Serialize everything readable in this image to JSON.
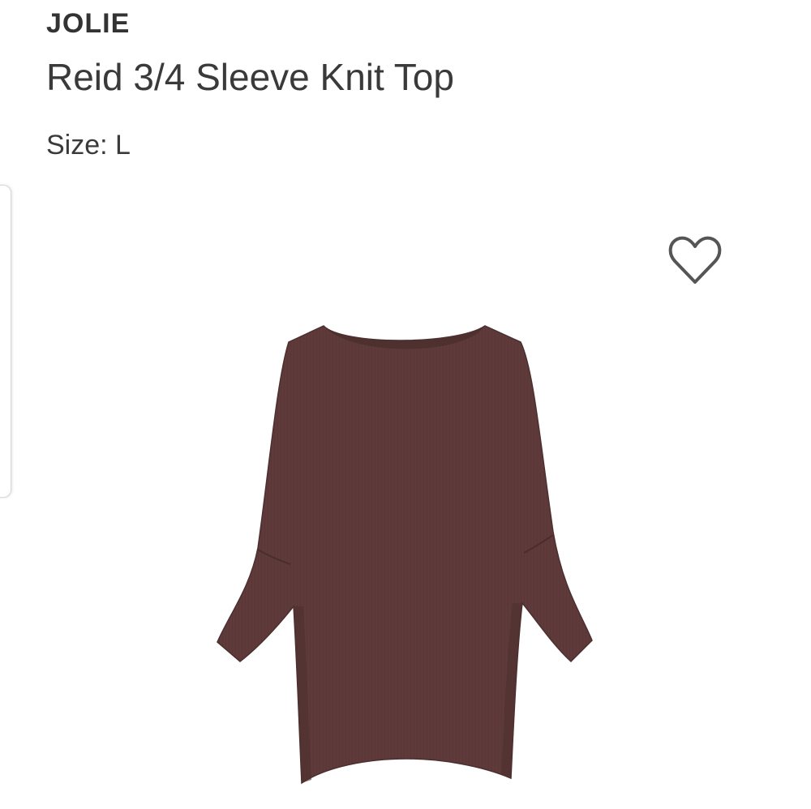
{
  "product": {
    "brand": "JOLIE",
    "name": "Reid 3/4 Sleeve Knit Top",
    "size_label": "Size:",
    "size_value": "L",
    "garment_color": "#5e3b3a"
  },
  "icons": {
    "favorite": "heart-outline-icon"
  },
  "colors": {
    "text": "#333333",
    "icon_stroke": "#555555",
    "background": "#ffffff"
  }
}
